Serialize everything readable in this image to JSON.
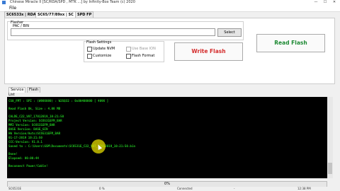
{
  "window": {
    "title": "Chinese Miracle II [SC/RDA/SPD , MTK ...] by Infinity-Box Team (c) 2020",
    "minimize": "—",
    "maximize": "☐",
    "close": "✕"
  },
  "menu": {
    "file": "File"
  },
  "tabs": [
    "SC6533x | RDA SC",
    "SC65/77/89xx | SC",
    "SPD FP"
  ],
  "flasher": {
    "group_label": "Flasher",
    "pac_label": "PAC / BIN",
    "pac_value": "",
    "select_label": "Select"
  },
  "flash_settings": {
    "label": "Flash Settings",
    "update_nvm": "Update NVM",
    "use_base_ion": "Use Base ION",
    "customize": "Customize",
    "flash_format": "Flash Format"
  },
  "buttons": {
    "write_flash": "Write Flash",
    "read_flash": "Read Flash"
  },
  "service_tabs": [
    "Service",
    "Flash"
  ],
  "list_label": "List",
  "log_lines": [
    "CS0_FMT : SPI : (W986080) : W25Q32 : 0x00400000 [ 4096 ]",
    "Read Flash Ok, Size : 4.00 MB",
    "CALDE_C22_V07_17012019_10:21:50",
    "Project Version: SC6531EFM_BAR",
    "MMI Version:      SC6531EFM_BAR",
    "BASE Version:    BASE_GIN",
    "HW Version/Auto)SC6531EFM_BAR",
    "01-17-2019 10:21:50",
    "CCC-Version:     V1.0.1",
    "Saved to : C:\\Users\\GSM\\Documents\\SC6531E_C22_V07_17012019_10:21:50.bin",
    "Done!",
    "Elapsed: 00:00:44",
    "Reconnect Power/Cable!"
  ],
  "progress": {
    "text": "0%",
    "value": 0
  },
  "status": {
    "s1": "SC6531E",
    "s2": "0 %",
    "s3": "Connected",
    "s4": "-",
    "s5": "12:38 PM"
  }
}
